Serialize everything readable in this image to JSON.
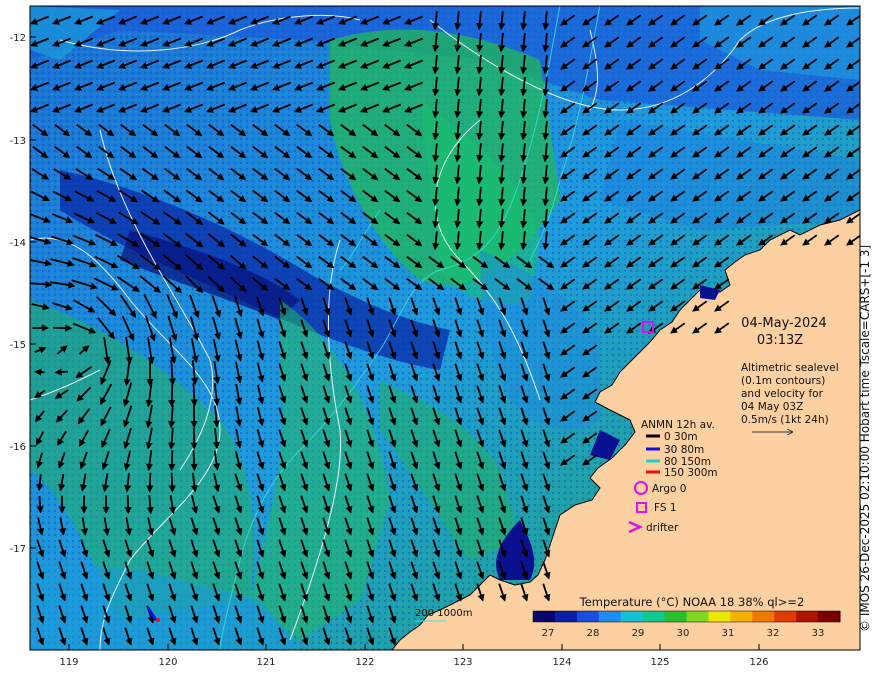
{
  "map": {
    "datetime_date": "04-May-2024",
    "datetime_time": "03:13Z",
    "description": [
      "Altimetric sealevel",
      "(0.1m contours)",
      "and velocity for",
      "04 May 03Z",
      "0.5m/s (1kt 24h)"
    ],
    "colorbar_title": "Temperature (°C) NOAA 18 38% ql>=2",
    "colorbar_ticks": [
      "27",
      "28",
      "29",
      "30",
      "31",
      "32",
      "33"
    ],
    "colorbar_colors": [
      "#06066e",
      "#0a1eaa",
      "#1a4ee0",
      "#1e8cf0",
      "#14c0d8",
      "#10c890",
      "#28c030",
      "#7cd820",
      "#e8e800",
      "#f4b000",
      "#f07800",
      "#e03c00",
      "#b01400",
      "#7a0000"
    ],
    "depth_label": "200  1000m",
    "lon_ticks": [
      "119",
      "120",
      "121",
      "122",
      "123",
      "124",
      "125",
      "126"
    ],
    "lat_ticks": [
      "-12",
      "-13",
      "-14",
      "-15",
      "-16",
      "-17"
    ],
    "legend": {
      "title": "ANMN 12h av.",
      "items": [
        {
          "label": "0 30m",
          "color": "#000000"
        },
        {
          "label": "30 80m",
          "color": "#1010e8"
        },
        {
          "label": "80 150m",
          "color": "#20d0d0"
        },
        {
          "label": "150 300m",
          "color": "#e81010"
        }
      ],
      "argo": "Argo 0",
      "fs": "FS 1",
      "drifter": "drifter",
      "marker_color": "#e010e0"
    },
    "credit": "© IMOS 26-Dec-2025 02:10:00 Hobart time Tscale=CARS+[-1 3]",
    "colors": {
      "land": "#fcd0a0",
      "ocean_warm": "#28b850",
      "ocean_mid": "#1e8ce8",
      "ocean_cool": "#0a2ab0"
    }
  }
}
